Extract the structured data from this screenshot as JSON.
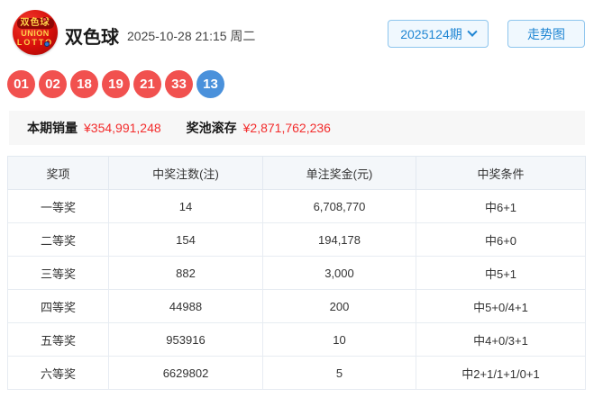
{
  "header": {
    "logo": {
      "line1": "双色球",
      "line2": "UNION",
      "line3": "LOTTO"
    },
    "title": "双色球",
    "datetime": "2025-10-28 21:15 周二",
    "issue_dropdown": {
      "label": "2025124期"
    },
    "trend_button_label": "走势图"
  },
  "balls": [
    {
      "number": "01",
      "color": "red"
    },
    {
      "number": "02",
      "color": "red"
    },
    {
      "number": "18",
      "color": "red"
    },
    {
      "number": "19",
      "color": "red"
    },
    {
      "number": "21",
      "color": "red"
    },
    {
      "number": "33",
      "color": "red"
    },
    {
      "number": "13",
      "color": "blue"
    }
  ],
  "summary": {
    "sales_label": "本期销量",
    "sales_value": "¥354,991,248",
    "pool_label": "奖池滚存",
    "pool_value": "¥2,871,762,236"
  },
  "table": {
    "headers": [
      "奖项",
      "中奖注数(注)",
      "单注奖金(元)",
      "中奖条件"
    ],
    "rows": [
      [
        "一等奖",
        "14",
        "6,708,770",
        "中6+1"
      ],
      [
        "二等奖",
        "154",
        "194,178",
        "中6+0"
      ],
      [
        "三等奖",
        "882",
        "3,000",
        "中5+1"
      ],
      [
        "四等奖",
        "44988",
        "200",
        "中5+0/4+1"
      ],
      [
        "五等奖",
        "953916",
        "10",
        "中4+0/3+1"
      ],
      [
        "六等奖",
        "6629802",
        "5",
        "中2+1/1+1/0+1"
      ]
    ]
  },
  "colors": {
    "red_ball": "#f1514f",
    "blue_ball": "#4a91db",
    "accent_blue": "#2086d3",
    "value_red": "#f32c2c",
    "band_gray": "#f7f7f7",
    "table_header_bg": "#f4f7fa"
  }
}
